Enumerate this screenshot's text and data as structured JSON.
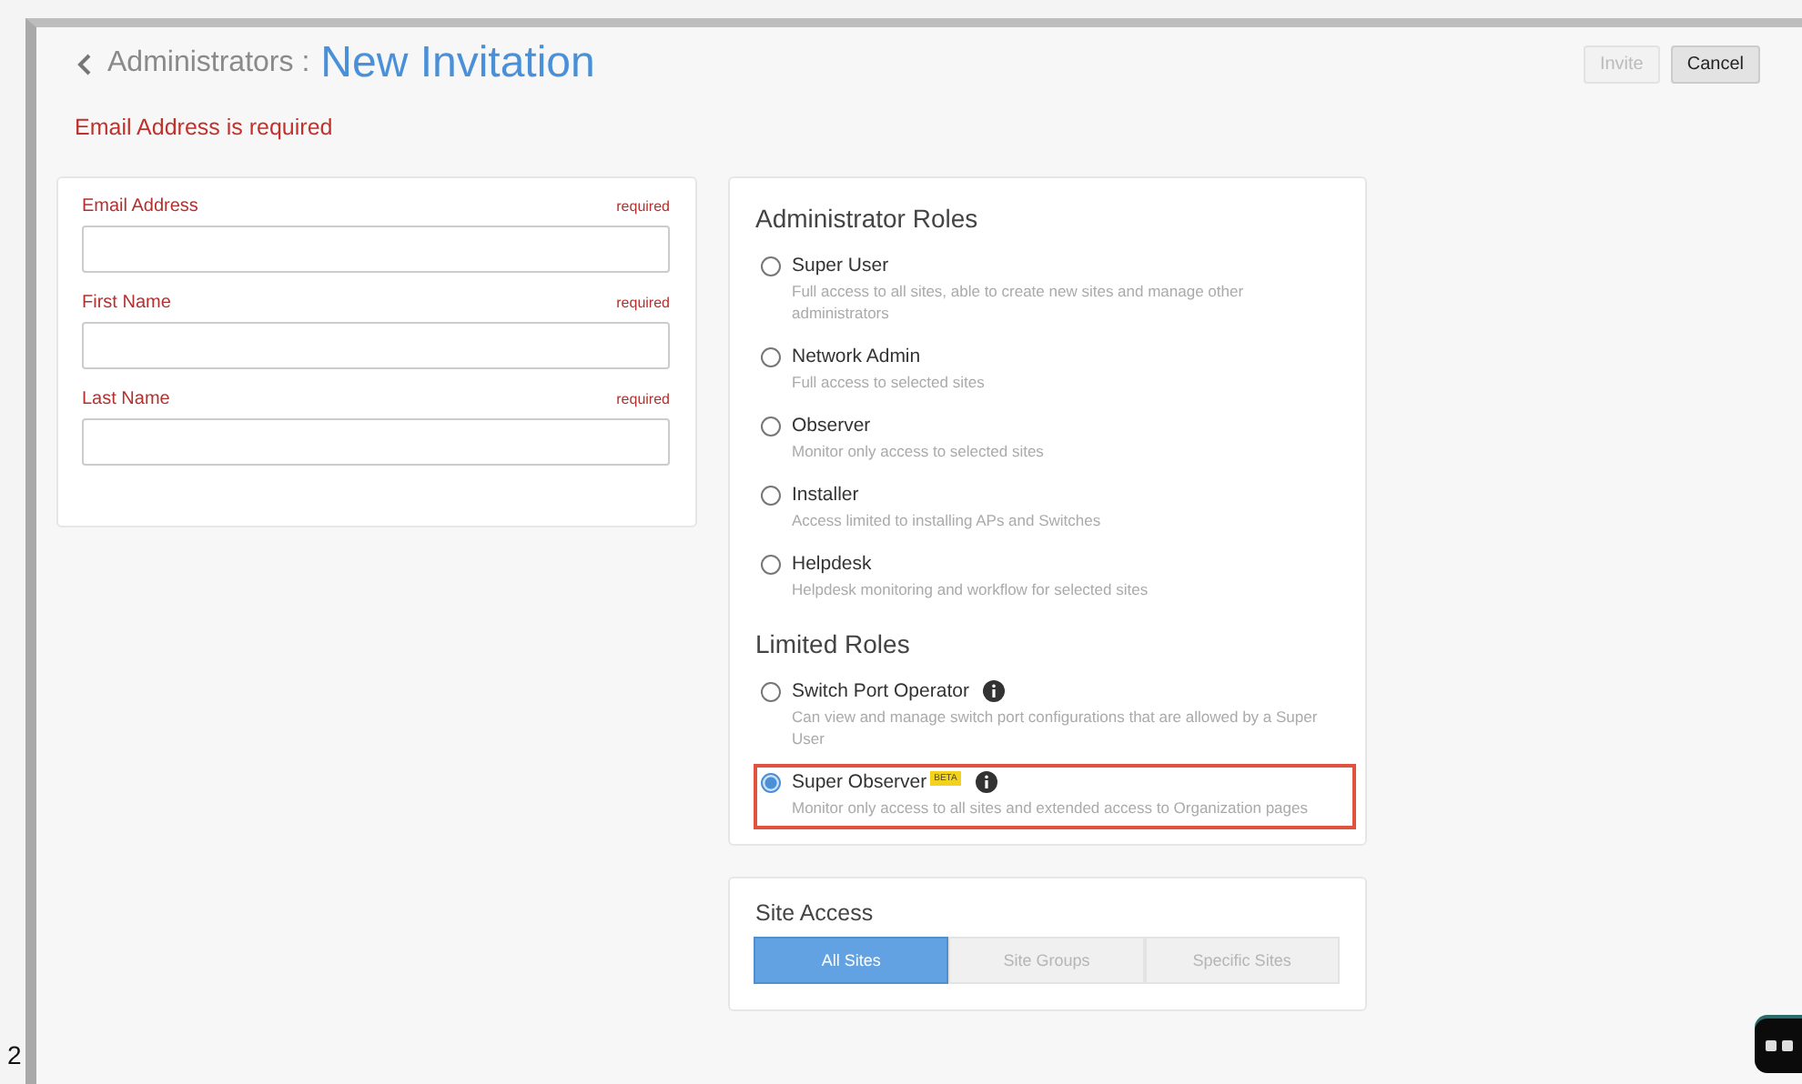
{
  "header": {
    "back_label": "Administrators :",
    "title": "New Invitation",
    "error": "Email Address is required"
  },
  "buttons": [
    {
      "label": "Invite",
      "disabled": true
    },
    {
      "label": "Cancel",
      "disabled": false
    }
  ],
  "form": {
    "fields": [
      {
        "label": "Email Address",
        "hint": "required"
      },
      {
        "label": "First Name",
        "hint": "required"
      },
      {
        "label": "Last Name",
        "hint": "required"
      }
    ]
  },
  "role_groups": [
    {
      "title": "Administrator Roles",
      "roles": [
        {
          "name": "Super User",
          "description": "Full access to all sites, able to create new sites and manage other administrators",
          "selected": false,
          "info": false,
          "highlighted": false
        },
        {
          "name": "Network Admin",
          "description": "Full access to selected sites",
          "selected": false,
          "info": false,
          "highlighted": false
        },
        {
          "name": "Observer",
          "description": "Monitor only access to selected sites",
          "selected": false,
          "info": false,
          "highlighted": false
        },
        {
          "name": "Installer",
          "description": "Access limited to installing APs and Switches",
          "selected": false,
          "info": false,
          "highlighted": false
        },
        {
          "name": "Helpdesk",
          "description": "Helpdesk monitoring and workflow for selected sites",
          "selected": false,
          "info": false,
          "highlighted": false
        }
      ]
    },
    {
      "title": "Limited Roles",
      "roles": [
        {
          "name": "Switch Port Operator",
          "description": "Can view and manage switch port configurations that are allowed by a Super User",
          "selected": false,
          "info": true,
          "highlighted": false
        },
        {
          "name": "Super Observer",
          "badge": "BETA",
          "description": "Monitor only access to all sites and extended access to Organization pages",
          "selected": true,
          "info": true,
          "highlighted": true
        }
      ]
    }
  ],
  "site_access": {
    "title": "Site Access",
    "options": [
      {
        "label": "All Sites",
        "selected": true
      },
      {
        "label": "Site Groups",
        "selected": false
      },
      {
        "label": "Specific Sites",
        "selected": false
      }
    ]
  },
  "edge_text": "2"
}
